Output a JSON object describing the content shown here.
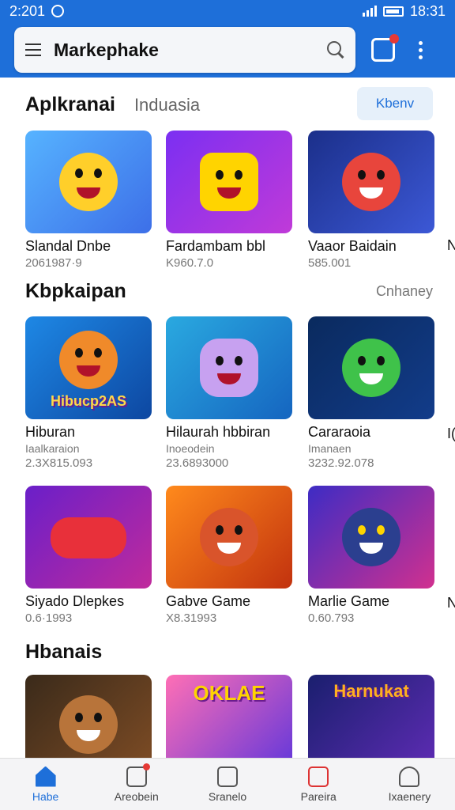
{
  "status_bar": {
    "time": "2:201",
    "clock": "18:31"
  },
  "search": {
    "text": "Markephake"
  },
  "section1": {
    "title": "Aplkranai",
    "subtitle": "Induasia",
    "button_label": "Kbenv"
  },
  "section2": {
    "title": "Kbpkaipan",
    "see_more": "Cnhaney"
  },
  "section3": {
    "title": "Hbanais"
  },
  "row1": [
    {
      "name": "Slandal Dnbe",
      "meta": "2061987·9"
    },
    {
      "name": "Fardambam bbl",
      "meta": "K960.7.0"
    },
    {
      "name": "Vaaor Baidain",
      "meta": "585.001"
    }
  ],
  "row2": [
    {
      "name": "Hiburan",
      "sub": "Iaalkaraion",
      "meta": "2.3X815.093",
      "art_label": "Hibucp2AS"
    },
    {
      "name": "Hilaurah hbbiran",
      "sub": "Inoeodein",
      "meta": "23.6893000"
    },
    {
      "name": "Cararaoia",
      "sub": "Imanaen",
      "meta": "3232.92.078"
    }
  ],
  "row3": [
    {
      "name": "Siyado Dlepkes",
      "meta": "0.6·1993"
    },
    {
      "name": "Gabve Game",
      "meta": "X8.31993"
    },
    {
      "name": "Marlie Game",
      "meta": "0.60.793"
    }
  ],
  "row4": [
    {
      "art_label": ""
    },
    {
      "art_label": "OKLAE"
    },
    {
      "art_label": "Harnukat"
    }
  ],
  "edge": {
    "n1": "N",
    "n2": "I(",
    "n3": "N"
  },
  "bottom_nav": [
    {
      "label": "Habe"
    },
    {
      "label": "Areobein"
    },
    {
      "label": "Sranelo"
    },
    {
      "label": "Pareira"
    },
    {
      "label": "Ixaenery"
    }
  ],
  "colors": {
    "brand": "#1e6fd9",
    "badge": "#e53935"
  }
}
